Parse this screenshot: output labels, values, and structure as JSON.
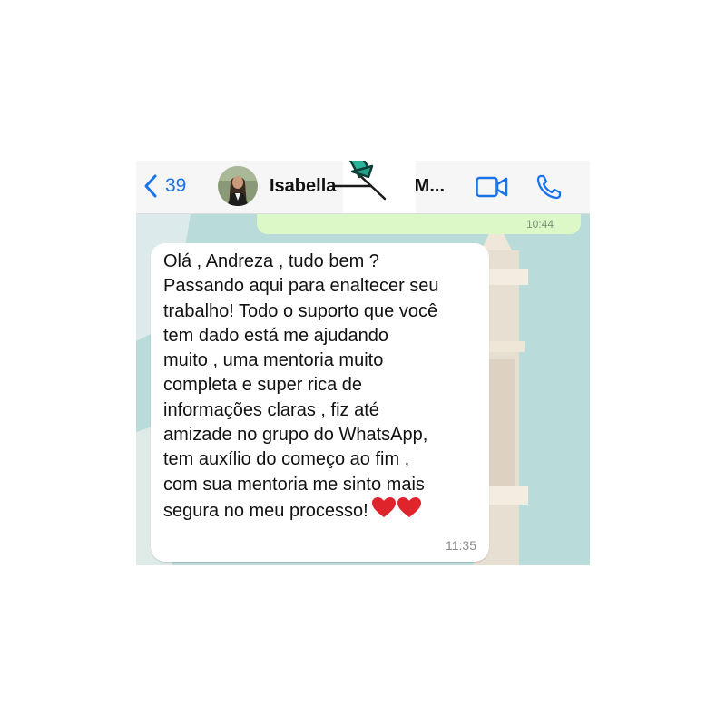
{
  "header": {
    "back_count": "39",
    "contact_name": "Isabella",
    "contact_name_suffix": "s M...",
    "icons": {
      "back": "chevron-left-icon",
      "video": "video-call-icon",
      "call": "phone-icon",
      "pin": "pushpin-icon"
    }
  },
  "chat": {
    "previous_message_time": "10:44",
    "message": {
      "lines": [
        "Olá , Andreza , tudo bem ?",
        "Passando aqui para enaltecer seu",
        "trabalho! Todo o suporto que você",
        "tem dado está me ajudando",
        "muito , uma mentoria muito",
        "completa e super rica de",
        "informações claras , fiz até",
        "amizade no grupo do WhatsApp,",
        "tem auxílio do começo ao fim ,",
        "com sua mentoria me sinto mais",
        "segura no meu processo!"
      ],
      "emoji": "❤️❤️",
      "time": "11:35"
    }
  },
  "colors": {
    "accent": "#1a73e8",
    "chat_bg": "#b8d9d8",
    "outgoing_bubble": "#dcf8c6",
    "pin": "#2bb39a"
  }
}
